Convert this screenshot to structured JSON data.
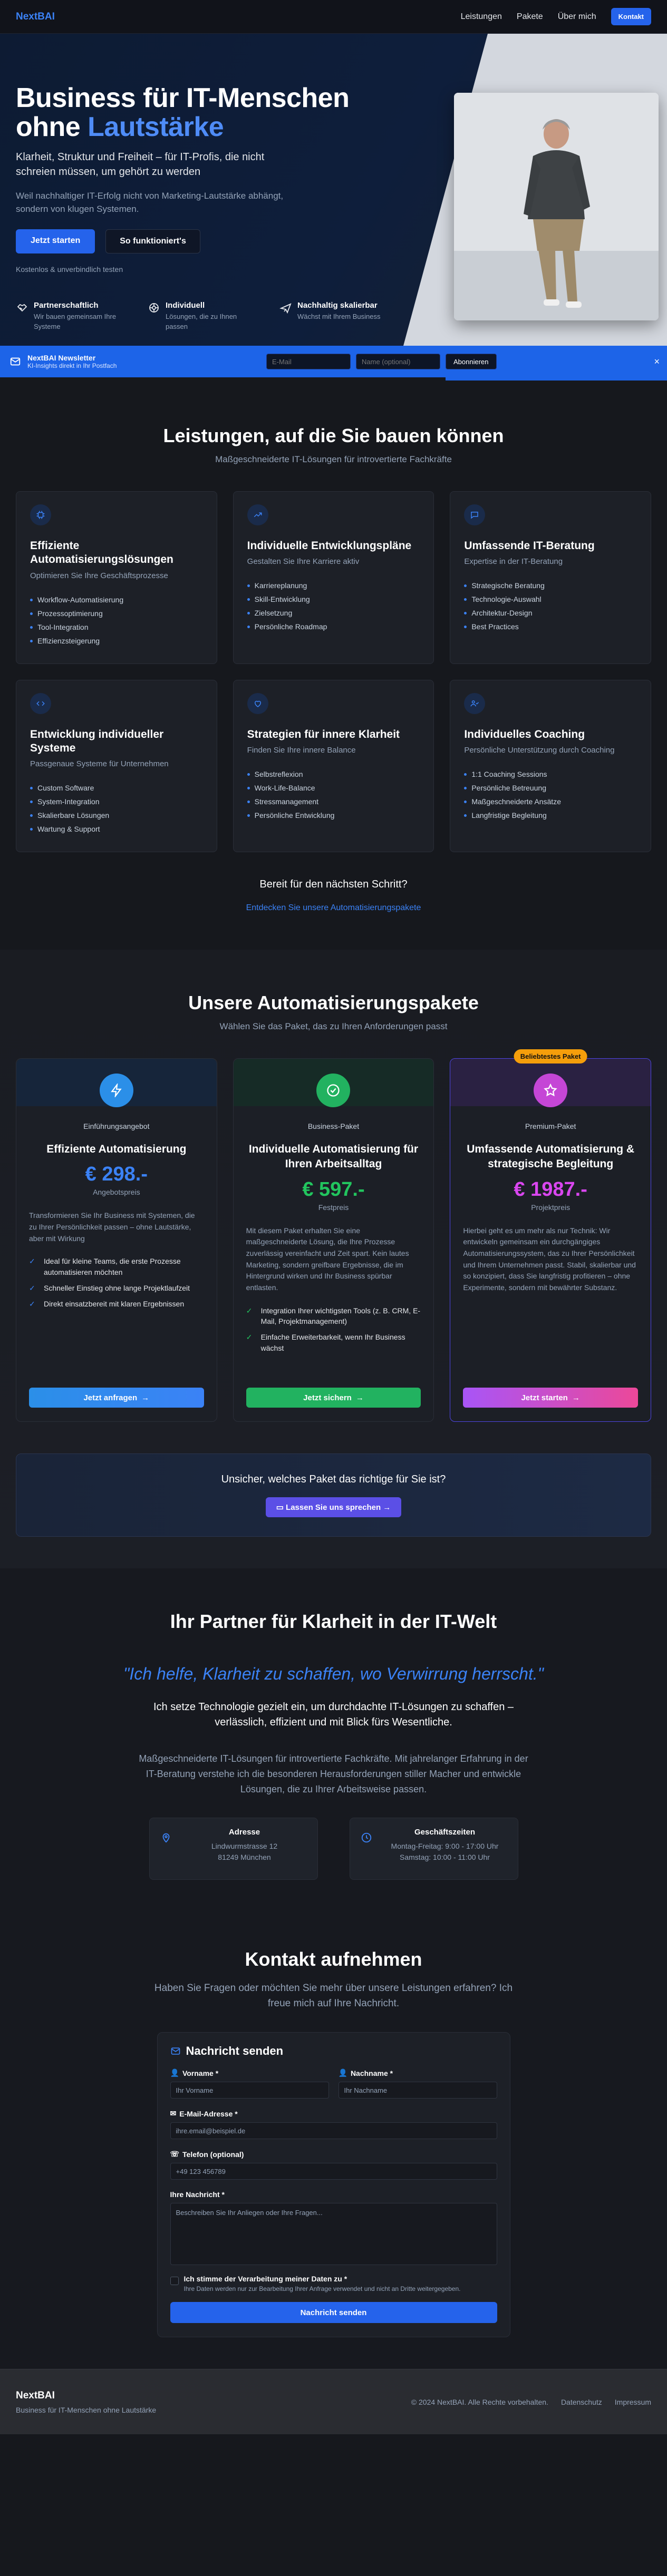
{
  "nav": {
    "logo": "NextBAI",
    "links": [
      "Leistungen",
      "Pakete",
      "Über mich"
    ],
    "cta": "Kontakt"
  },
  "hero": {
    "title_line1": "Business für IT-Menschen",
    "title_line2_prefix": "ohne ",
    "title_line2_highlight": "Lautstärke",
    "subtitle": "Klarheit, Struktur und Freiheit – für IT-Profis, die nicht schreien müssen, um gehört zu werden",
    "description": "Weil nachhaltiger IT-Erfolg nicht von Marketing-Lautstärke abhängt, sondern von klugen Systemen.",
    "primary_button": "Jetzt starten",
    "secondary_button": "So funktioniert's",
    "note": "Kostenlos & unverbindlich testen",
    "features": [
      {
        "icon": "handshake-icon",
        "title": "Partnerschaftlich",
        "text": "Wir bauen gemeinsam Ihre Systeme"
      },
      {
        "icon": "brain-icon",
        "title": "Individuell",
        "text": "Lösungen, die zu Ihnen passen"
      },
      {
        "icon": "plane-icon",
        "title": "Nachhaltig skalierbar",
        "text": "Wächst mit Ihrem Business"
      }
    ]
  },
  "newsletter": {
    "title": "NextBAI Newsletter",
    "subtitle": "KI-Insights direkt in Ihr Postfach",
    "email_placeholder": "E-Mail",
    "name_placeholder": "Name (optional)",
    "button": "Abonnieren",
    "close": "×"
  },
  "services": {
    "title": "Leistungen, auf die Sie bauen können",
    "subtitle": "Maßgeschneiderte IT-Lösungen für introvertierte Fachkräfte",
    "cards": [
      {
        "icon": "chip-icon",
        "title": "Effiziente Automatisierungslösungen",
        "tag": "Optimieren Sie Ihre Geschäftsprozesse",
        "items": [
          "Workflow-Automatisierung",
          "Prozessoptimierung",
          "Tool-Integration",
          "Effizienzsteigerung"
        ]
      },
      {
        "icon": "trending-up-icon",
        "title": "Individuelle Entwicklungspläne",
        "tag": "Gestalten Sie Ihre Karriere aktiv",
        "items": [
          "Karriereplanung",
          "Skill-Entwicklung",
          "Zielsetzung",
          "Persönliche Roadmap"
        ]
      },
      {
        "icon": "chat-icon",
        "title": "Umfassende IT-Beratung",
        "tag": "Expertise in der IT-Beratung",
        "items": [
          "Strategische Beratung",
          "Technologie-Auswahl",
          "Architektur-Design",
          "Best Practices"
        ]
      },
      {
        "icon": "code-icon",
        "title": "Entwicklung individueller Systeme",
        "tag": "Passgenaue Systeme für Unternehmen",
        "items": [
          "Custom Software",
          "System-Integration",
          "Skalierbare Lösungen",
          "Wartung & Support"
        ]
      },
      {
        "icon": "heart-icon",
        "title": "Strategien für innere Klarheit",
        "tag": "Finden Sie Ihre innere Balance",
        "items": [
          "Selbstreflexion",
          "Work-Life-Balance",
          "Stressmanagement",
          "Persönliche Entwicklung"
        ]
      },
      {
        "icon": "users-icon",
        "title": "Individuelles Coaching",
        "tag": "Persönliche Unterstützung durch Coaching",
        "items": [
          "1:1 Coaching Sessions",
          "Persönliche Betreuung",
          "Maßgeschneiderte Ansätze",
          "Langfristige Begleitung"
        ]
      }
    ],
    "next_question": "Bereit für den nächsten Schritt?",
    "next_link": "Entdecken Sie unsere Automatisierungspakete"
  },
  "packages": {
    "title": "Unsere Automatisierungspakete",
    "subtitle": "Wählen Sie das Paket, das zu Ihren Anforderungen passt",
    "popular_badge": "Beliebtestes Paket",
    "cards": [
      {
        "icon": "bolt-icon",
        "level": "Einführungsangebot",
        "title": "Effiziente Automatisierung",
        "price": "€ 298.-",
        "type": "Angebotspreis",
        "desc": "Transformieren Sie Ihr Business mit Systemen, die zu Ihrer Persönlichkeit passen – ohne Lautstärke, aber mit Wirkung",
        "items": [
          "Ideal für kleine Teams, die erste Prozesse automatisieren möchten",
          "Schneller Einstieg ohne lange Projektlaufzeit",
          "Direkt einsatzbereit mit klaren Ergebnissen"
        ],
        "button": "Jetzt anfragen",
        "check_color": "#3b82f6"
      },
      {
        "icon": "check-circle-icon",
        "level": "Business-Paket",
        "title": "Individuelle Automatisierung für Ihren Arbeitsalltag",
        "price": "€ 597.-",
        "type": "Festpreis",
        "desc": "Mit diesem Paket erhalten Sie eine maßgeschneiderte Lösung, die Ihre Prozesse zuverlässig vereinfacht und Zeit spart. Kein lautes Marketing, sondern greifbare Ergebnisse, die im Hintergrund wirken und Ihr Business spürbar entlasten.",
        "items": [
          "Integration Ihrer wichtigsten Tools (z. B. CRM, E-Mail, Projektmanagement)",
          "Einfache Erweiterbarkeit, wenn Ihr Business wächst"
        ],
        "button": "Jetzt sichern",
        "check_color": "#22c55e"
      },
      {
        "icon": "star-icon",
        "level": "Premium-Paket",
        "title": "Umfassende Automatisierung & strategische Begleitung",
        "price": "€ 1987.-",
        "type": "Projektpreis",
        "desc": "Hierbei geht es um mehr als nur Technik: Wir entwickeln gemeinsam ein durchgängiges Automatisierungssystem, das zu Ihrer Persönlichkeit und Ihrem Unternehmen passt. Stabil, skalierbar und so konzipiert, dass Sie langfristig profitieren – ohne Experimente, sondern mit bewährter Substanz.",
        "items": [],
        "button": "Jetzt starten",
        "check_color": "#d946ef"
      }
    ],
    "unsure_question": "Unsicher, welches Paket das richtige für Sie ist?",
    "unsure_button": "Lassen Sie uns sprechen"
  },
  "about": {
    "title": "Ihr Partner für Klarheit in der IT-Welt",
    "quote": "\"Ich helfe, Klarheit zu schaffen, wo Verwirrung herrscht.\"",
    "para1": "Ich setze Technologie gezielt ein, um durchdachte IT-Lösungen zu schaffen – verlässlich, effizient und mit Blick fürs Wesentliche.",
    "para2": "Maßgeschneiderte IT-Lösungen für introvertierte Fachkräfte. Mit jahrelanger Erfahrung in der IT-Beratung verstehe ich die besonderen Herausforderungen stiller Macher und entwickle Lösungen, die zu Ihrer Arbeitsweise passen.",
    "address_title": "Adresse",
    "address_line1": "Lindwurmstrasse 12",
    "address_line2": "81249 München",
    "hours_title": "Geschäftszeiten",
    "hours_line1": "Montag-Freitag: 9:00 - 17:00 Uhr",
    "hours_line2": "Samstag: 10:00 - 11:00 Uhr"
  },
  "contact": {
    "title": "Kontakt aufnehmen",
    "lead": "Haben Sie Fragen oder möchten Sie mehr über unsere Leistungen erfahren? Ich freue mich auf Ihre Nachricht.",
    "form_title": "Nachricht senden",
    "first_name_label": "Vorname *",
    "first_name_placeholder": "Ihr Vorname",
    "last_name_label": "Nachname *",
    "last_name_placeholder": "Ihr Nachname",
    "email_label": "E-Mail-Adresse *",
    "email_placeholder": "ihre.email@beispiel.de",
    "phone_label": "Telefon (optional)",
    "phone_placeholder": "+49 123 456789",
    "message_label": "Ihre Nachricht *",
    "message_placeholder": "Beschreiben Sie Ihr Anliegen oder Ihre Fragen...",
    "consent_title": "Ich stimme der Verarbeitung meiner Daten zu *",
    "consent_text": "Ihre Daten werden nur zur Bearbeitung Ihrer Anfrage verwendet und nicht an Dritte weitergegeben.",
    "submit": "Nachricht senden"
  },
  "footer": {
    "brand": "NextBAI",
    "tagline": "Business für IT-Menschen ohne Lautstärke",
    "copyright": "© 2024 NextBAI. Alle Rechte vorbehalten.",
    "links": [
      "Datenschutz",
      "Impressum"
    ]
  }
}
